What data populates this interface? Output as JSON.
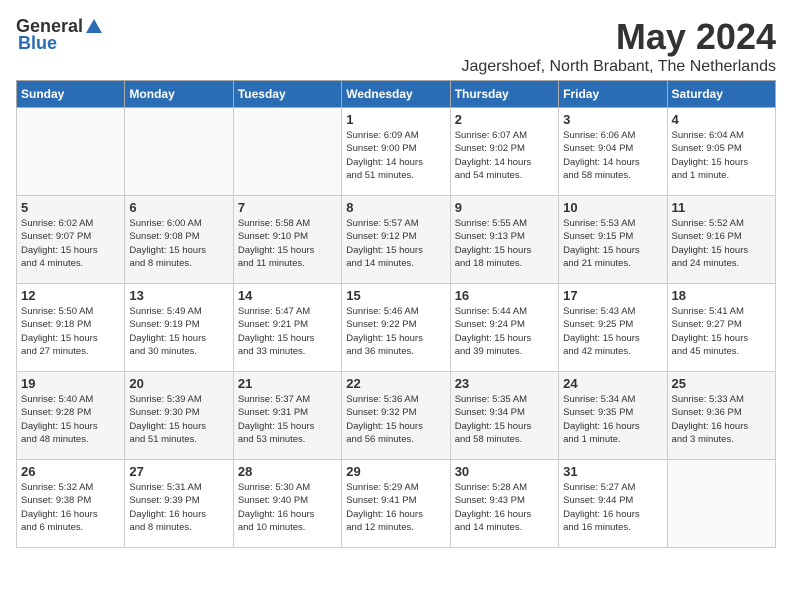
{
  "logo": {
    "general": "General",
    "blue": "Blue"
  },
  "title": "May 2024",
  "location": "Jagershoef, North Brabant, The Netherlands",
  "weekdays": [
    "Sunday",
    "Monday",
    "Tuesday",
    "Wednesday",
    "Thursday",
    "Friday",
    "Saturday"
  ],
  "weeks": [
    [
      {
        "day": "",
        "detail": ""
      },
      {
        "day": "",
        "detail": ""
      },
      {
        "day": "",
        "detail": ""
      },
      {
        "day": "1",
        "detail": "Sunrise: 6:09 AM\nSunset: 9:00 PM\nDaylight: 14 hours\nand 51 minutes."
      },
      {
        "day": "2",
        "detail": "Sunrise: 6:07 AM\nSunset: 9:02 PM\nDaylight: 14 hours\nand 54 minutes."
      },
      {
        "day": "3",
        "detail": "Sunrise: 6:06 AM\nSunset: 9:04 PM\nDaylight: 14 hours\nand 58 minutes."
      },
      {
        "day": "4",
        "detail": "Sunrise: 6:04 AM\nSunset: 9:05 PM\nDaylight: 15 hours\nand 1 minute."
      }
    ],
    [
      {
        "day": "5",
        "detail": "Sunrise: 6:02 AM\nSunset: 9:07 PM\nDaylight: 15 hours\nand 4 minutes."
      },
      {
        "day": "6",
        "detail": "Sunrise: 6:00 AM\nSunset: 9:08 PM\nDaylight: 15 hours\nand 8 minutes."
      },
      {
        "day": "7",
        "detail": "Sunrise: 5:58 AM\nSunset: 9:10 PM\nDaylight: 15 hours\nand 11 minutes."
      },
      {
        "day": "8",
        "detail": "Sunrise: 5:57 AM\nSunset: 9:12 PM\nDaylight: 15 hours\nand 14 minutes."
      },
      {
        "day": "9",
        "detail": "Sunrise: 5:55 AM\nSunset: 9:13 PM\nDaylight: 15 hours\nand 18 minutes."
      },
      {
        "day": "10",
        "detail": "Sunrise: 5:53 AM\nSunset: 9:15 PM\nDaylight: 15 hours\nand 21 minutes."
      },
      {
        "day": "11",
        "detail": "Sunrise: 5:52 AM\nSunset: 9:16 PM\nDaylight: 15 hours\nand 24 minutes."
      }
    ],
    [
      {
        "day": "12",
        "detail": "Sunrise: 5:50 AM\nSunset: 9:18 PM\nDaylight: 15 hours\nand 27 minutes."
      },
      {
        "day": "13",
        "detail": "Sunrise: 5:49 AM\nSunset: 9:19 PM\nDaylight: 15 hours\nand 30 minutes."
      },
      {
        "day": "14",
        "detail": "Sunrise: 5:47 AM\nSunset: 9:21 PM\nDaylight: 15 hours\nand 33 minutes."
      },
      {
        "day": "15",
        "detail": "Sunrise: 5:46 AM\nSunset: 9:22 PM\nDaylight: 15 hours\nand 36 minutes."
      },
      {
        "day": "16",
        "detail": "Sunrise: 5:44 AM\nSunset: 9:24 PM\nDaylight: 15 hours\nand 39 minutes."
      },
      {
        "day": "17",
        "detail": "Sunrise: 5:43 AM\nSunset: 9:25 PM\nDaylight: 15 hours\nand 42 minutes."
      },
      {
        "day": "18",
        "detail": "Sunrise: 5:41 AM\nSunset: 9:27 PM\nDaylight: 15 hours\nand 45 minutes."
      }
    ],
    [
      {
        "day": "19",
        "detail": "Sunrise: 5:40 AM\nSunset: 9:28 PM\nDaylight: 15 hours\nand 48 minutes."
      },
      {
        "day": "20",
        "detail": "Sunrise: 5:39 AM\nSunset: 9:30 PM\nDaylight: 15 hours\nand 51 minutes."
      },
      {
        "day": "21",
        "detail": "Sunrise: 5:37 AM\nSunset: 9:31 PM\nDaylight: 15 hours\nand 53 minutes."
      },
      {
        "day": "22",
        "detail": "Sunrise: 5:36 AM\nSunset: 9:32 PM\nDaylight: 15 hours\nand 56 minutes."
      },
      {
        "day": "23",
        "detail": "Sunrise: 5:35 AM\nSunset: 9:34 PM\nDaylight: 15 hours\nand 58 minutes."
      },
      {
        "day": "24",
        "detail": "Sunrise: 5:34 AM\nSunset: 9:35 PM\nDaylight: 16 hours\nand 1 minute."
      },
      {
        "day": "25",
        "detail": "Sunrise: 5:33 AM\nSunset: 9:36 PM\nDaylight: 16 hours\nand 3 minutes."
      }
    ],
    [
      {
        "day": "26",
        "detail": "Sunrise: 5:32 AM\nSunset: 9:38 PM\nDaylight: 16 hours\nand 6 minutes."
      },
      {
        "day": "27",
        "detail": "Sunrise: 5:31 AM\nSunset: 9:39 PM\nDaylight: 16 hours\nand 8 minutes."
      },
      {
        "day": "28",
        "detail": "Sunrise: 5:30 AM\nSunset: 9:40 PM\nDaylight: 16 hours\nand 10 minutes."
      },
      {
        "day": "29",
        "detail": "Sunrise: 5:29 AM\nSunset: 9:41 PM\nDaylight: 16 hours\nand 12 minutes."
      },
      {
        "day": "30",
        "detail": "Sunrise: 5:28 AM\nSunset: 9:43 PM\nDaylight: 16 hours\nand 14 minutes."
      },
      {
        "day": "31",
        "detail": "Sunrise: 5:27 AM\nSunset: 9:44 PM\nDaylight: 16 hours\nand 16 minutes."
      },
      {
        "day": "",
        "detail": ""
      }
    ]
  ]
}
